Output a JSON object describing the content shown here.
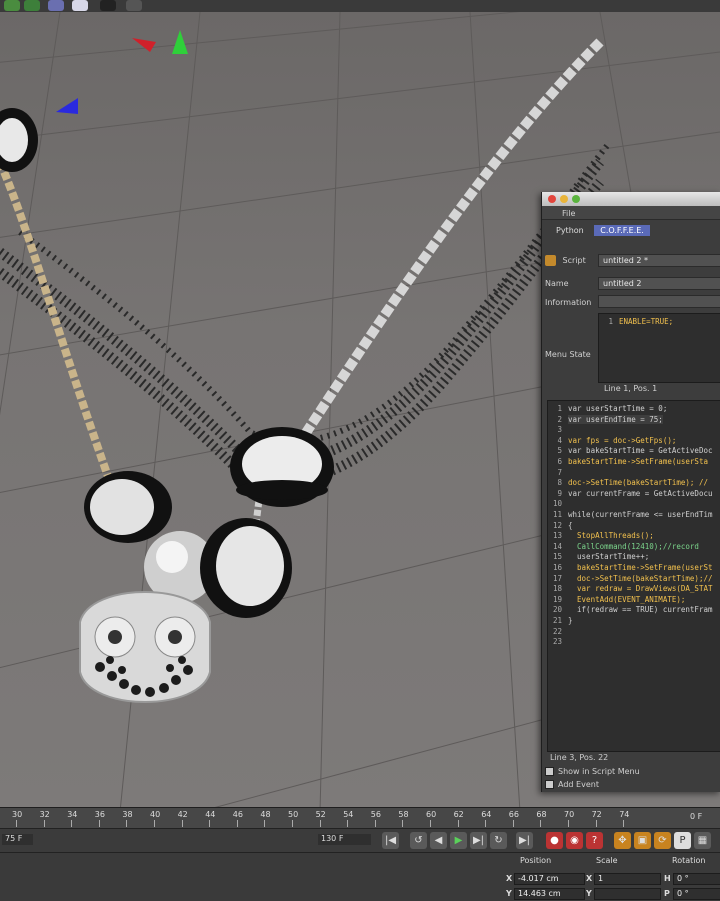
{
  "script_manager": {
    "menu": "File",
    "tabs": [
      "Python",
      "C.O.F.F.E.E."
    ],
    "active_tab": 1,
    "script_label": "Script",
    "script_value": "untitled 2 *",
    "name_label": "Name",
    "name_value": "untitled 2",
    "information_label": "Information",
    "menu_state_label": "Menu State",
    "menu_state_code": "ENABLE=TRUE;",
    "menu_state_status": "Line 1, Pos. 1",
    "code_lines": [
      "var userStartTime = 0;",
      "var userEndTime = 75;",
      "",
      "var fps = doc->GetFps();",
      "var bakeStartTime = GetActiveDoc",
      "bakeStartTime->SetFrame(userSta",
      "",
      "doc->SetTime(bakeStartTime); //",
      "var currentFrame = GetActiveDocu",
      "",
      "while(currentFrame <= userEndTim",
      "{",
      "  StopAllThreads();",
      "  CallCommand(12410);//record",
      "  userStartTime++;",
      "  bakeStartTime->SetFrame(userSt",
      "  doc->SetTime(bakeStartTime);//",
      "  var redraw = DrawViews(DA_STAT",
      "  EventAdd(EVENT_ANIMATE);",
      "  if(redraw == TRUE) currentFram",
      "}",
      "",
      ""
    ],
    "editor_status": "Line 3, Pos. 22",
    "show_in_menu_label": "Show in Script Menu",
    "add_event_label": "Add Event"
  },
  "timeline": {
    "ticks": [
      "30",
      "32",
      "34",
      "36",
      "38",
      "40",
      "42",
      "44",
      "46",
      "48",
      "50",
      "52",
      "54",
      "56",
      "58",
      "60",
      "62",
      "64",
      "66",
      "68",
      "70",
      "72",
      "74"
    ],
    "frame_readout": "0 F"
  },
  "playback": {
    "start_field": "75 F",
    "end_field": "130 F"
  },
  "coordinates": {
    "position_header": "Position",
    "scale_header": "Scale",
    "rotation_header": "Rotation",
    "pos_x": "-4.017 cm",
    "pos_y": "14.463 cm",
    "scale_x": "1",
    "rot_h": "0 °",
    "rot_p": "0 °",
    "axis_x": "X",
    "axis_y": "Y",
    "axis_h": "H",
    "axis_p": "P"
  },
  "colors": {
    "active_tab": "#5a6ab8",
    "keyword_yellow": "#f2c14e",
    "comment_green": "#7bd48b"
  }
}
